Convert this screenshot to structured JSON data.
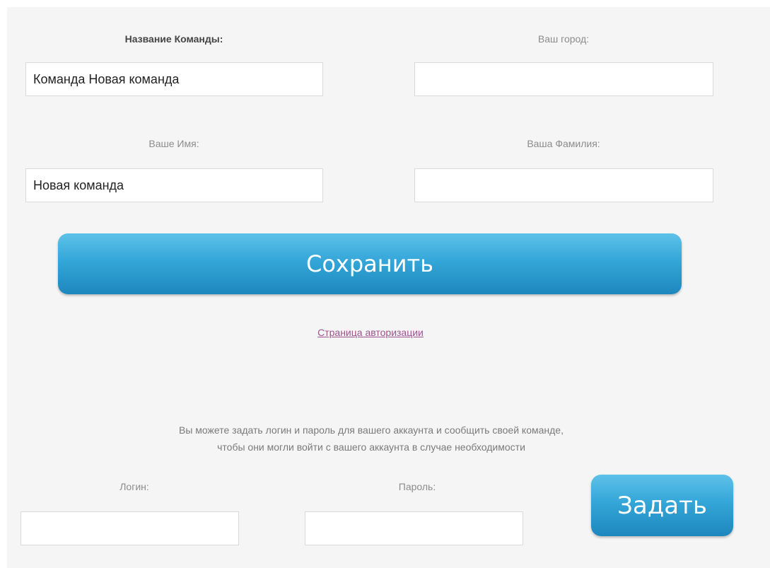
{
  "form": {
    "team_name_label": "Название Команды:",
    "team_name_value": "Команда Новая команда",
    "city_label": "Ваш город:",
    "city_value": "",
    "first_name_label": "Ваше Имя:",
    "first_name_value": "Новая команда",
    "last_name_label": "Ваша Фамилия:",
    "last_name_value": "",
    "save_label": "Сохранить",
    "auth_link": "Страница авторизации"
  },
  "credentials": {
    "info_line1": "Вы можете задать логин и пароль для вашего аккаунта и сообщить своей команде,",
    "info_line2": "чтобы они могли войти с вашего аккаунта в случае необходимости",
    "login_label": "Логин:",
    "login_value": "",
    "password_label": "Пароль:",
    "password_value": "",
    "set_label": "Задать"
  },
  "colors": {
    "background": "#f5f5f5",
    "button_top": "#5ec2e9",
    "button_bottom": "#1d87bd",
    "link": "#a0528f"
  }
}
